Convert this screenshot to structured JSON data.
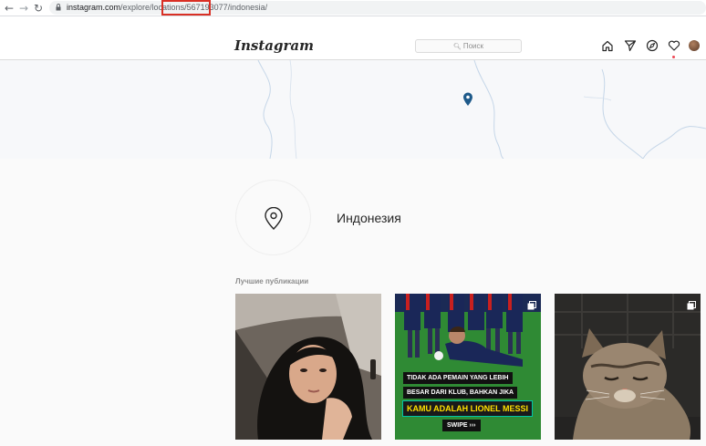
{
  "browser": {
    "url_domain": "instagram.com",
    "url_path": "/explore/locations/567193077/indonesia/",
    "back_icon": "arrow-left-icon",
    "forward_icon": "arrow-right-icon",
    "reload_icon": "reload-icon"
  },
  "header": {
    "logo": "Instagram",
    "search_placeholder": "Поиск",
    "icons": [
      "home-icon",
      "direct-icon",
      "explore-icon",
      "heart-icon",
      "avatar"
    ]
  },
  "location": {
    "name": "Индонезия",
    "pin_color": "#1e5a8a"
  },
  "top_posts": {
    "title": "Лучшие публикации",
    "posts": [
      {
        "kind": "selfie-photo",
        "multi": false
      },
      {
        "kind": "football-graphic",
        "multi": true,
        "lines": [
          "TIDAK ADA PEMAIN YANG LEBIH",
          "BESAR DARI KLUB, BAHKAN JIKA",
          "KAMU ADALAH LIONEL MESSI",
          "SWIPE ›››"
        ]
      },
      {
        "kind": "cat-photo",
        "multi": true
      }
    ]
  },
  "colors": {
    "highlight": "#d93025",
    "notif": "#ed4956"
  }
}
